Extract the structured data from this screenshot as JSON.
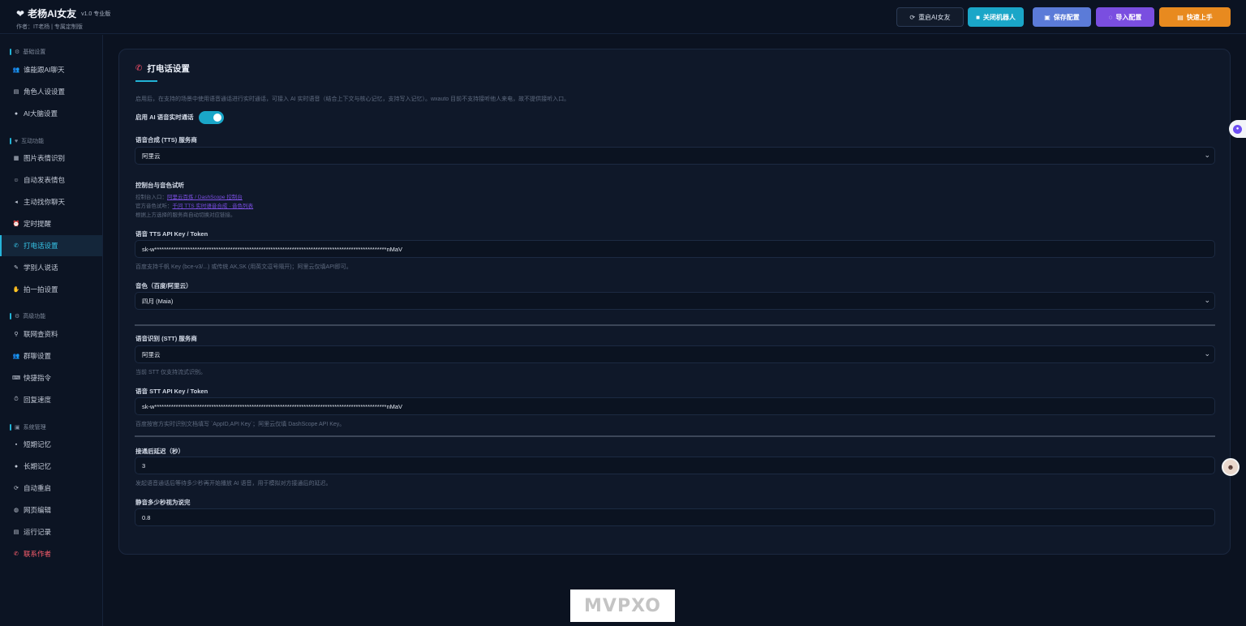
{
  "header": {
    "title": "老杨AI女友",
    "version": "v1.0 专业版",
    "subtitle": "作者：IT老杨 | 专属定制版",
    "buttons": {
      "restart": "重启AI女友",
      "close_bot": "关闭机器人",
      "save": "保存配置",
      "import": "导入配置",
      "quick_start": "快速上手"
    }
  },
  "sidebar": {
    "sections": {
      "basic": "基础设置",
      "interact": "互动功能",
      "advanced": "高级功能",
      "system": "系统管理"
    },
    "items": [
      "谁能跟AI聊天",
      "角色人设设置",
      "AI大脑设置",
      "图片表情识别",
      "自动发表情包",
      "主动找你聊天",
      "定时提醒",
      "打电话设置",
      "学别人说话",
      "拍一拍设置",
      "联网查资料",
      "群聊设置",
      "快捷指令",
      "回复速度",
      "短期记忆",
      "长期记忆",
      "自动重启",
      "网页编辑",
      "运行记录",
      "联系作者"
    ]
  },
  "main": {
    "title": "打电话设置",
    "intro": "启用后，在支持的场景中使用语音通话进行实时通话，可接入 AI 实时语音（结合上下文与核心记忆，支持写入记忆）。wxauto 目前不支持接听他人来电，故不提供接听入口。",
    "enable_label": "启用 AI 语音实时通话",
    "enabled": true,
    "tts_provider_label": "语音合成 (TTS) 服务商",
    "tts_provider_value": "阿里云",
    "console_label": "控制台与音色试听",
    "console_line1_prefix": "控制台入口：",
    "console_line1_link": "阿里云百炼 / DashScope 控制台",
    "console_line2_prefix": "官方音色试听：",
    "console_line2_link": "千问 TTS 实时语音合成 · 音色列表",
    "console_line3": "根据上方选择的服务商自动切换对应链接。",
    "tts_key_label": "语音 TTS API Key / Token",
    "tts_key_value": "sk-w**************************************************************************************************nMaV",
    "tts_key_hint": "百度支持千帆 Key (bce-v3/...) 或传统 AK,SK (用英文逗号隔开)；阿里云仅填API即可。",
    "voice_label": "音色（百度/阿里云）",
    "voice_value": "四月 (Maia)",
    "stt_provider_label": "语音识别 (STT) 服务商",
    "stt_provider_value": "阿里云",
    "stt_provider_hint": "当前 STT 仅支持流式识别。",
    "stt_key_label": "语音 STT API Key / Token",
    "stt_key_value": "sk-w**************************************************************************************************nMaV",
    "stt_key_hint": "百度按官方实时识别文档填写 `AppID,API Key`；阿里云仅填 DashScope API Key。",
    "delay_label": "接通后延迟（秒）",
    "delay_value": "3",
    "delay_hint": "发起语音通话后等待多少秒再开始播放 AI 语音，用于模拟对方接通后的延迟。",
    "silence_label": "静音多少秒视为说完",
    "silence_value": "0.8"
  },
  "watermark": "MVPXO",
  "colors": {
    "accent": "#22b3d6",
    "background": "#0b1220",
    "card": "#0f1829",
    "danger": "#ff5f6e"
  }
}
